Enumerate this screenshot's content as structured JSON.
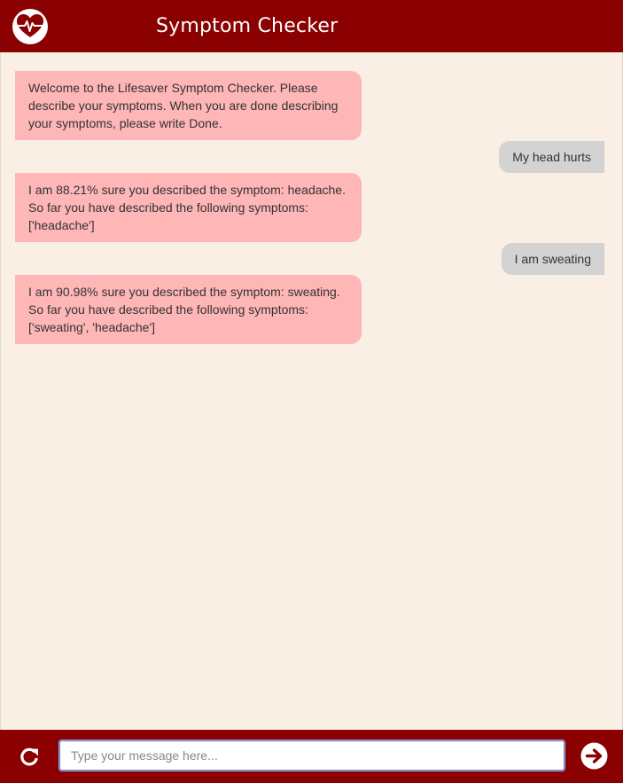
{
  "header": {
    "title": "Symptom Checker",
    "logo_icon": "heart-pulse-icon"
  },
  "messages": [
    {
      "sender": "bot",
      "text": "Welcome to the Lifesaver Symptom Checker. Please describe your symptoms. When you are done describing your symptoms, please write Done."
    },
    {
      "sender": "user",
      "text": "My head hurts"
    },
    {
      "sender": "bot",
      "text": "I am 88.21% sure you described the symptom: headache. So far you have described the following symptoms: ['headache']"
    },
    {
      "sender": "user",
      "text": "I am sweating"
    },
    {
      "sender": "bot",
      "text": "I am 90.98% sure you described the symptom: sweating. So far you have described the following symptoms: ['sweating', 'headache']"
    }
  ],
  "composer": {
    "placeholder": "Type your message here...",
    "value": "",
    "refresh_icon": "refresh-icon",
    "send_icon": "arrow-right-circle-icon"
  },
  "colors": {
    "brand": "#8b0000",
    "background": "#f9efe5",
    "bot_bubble": "#ffb6b6",
    "user_bubble": "#d3d3d3"
  }
}
